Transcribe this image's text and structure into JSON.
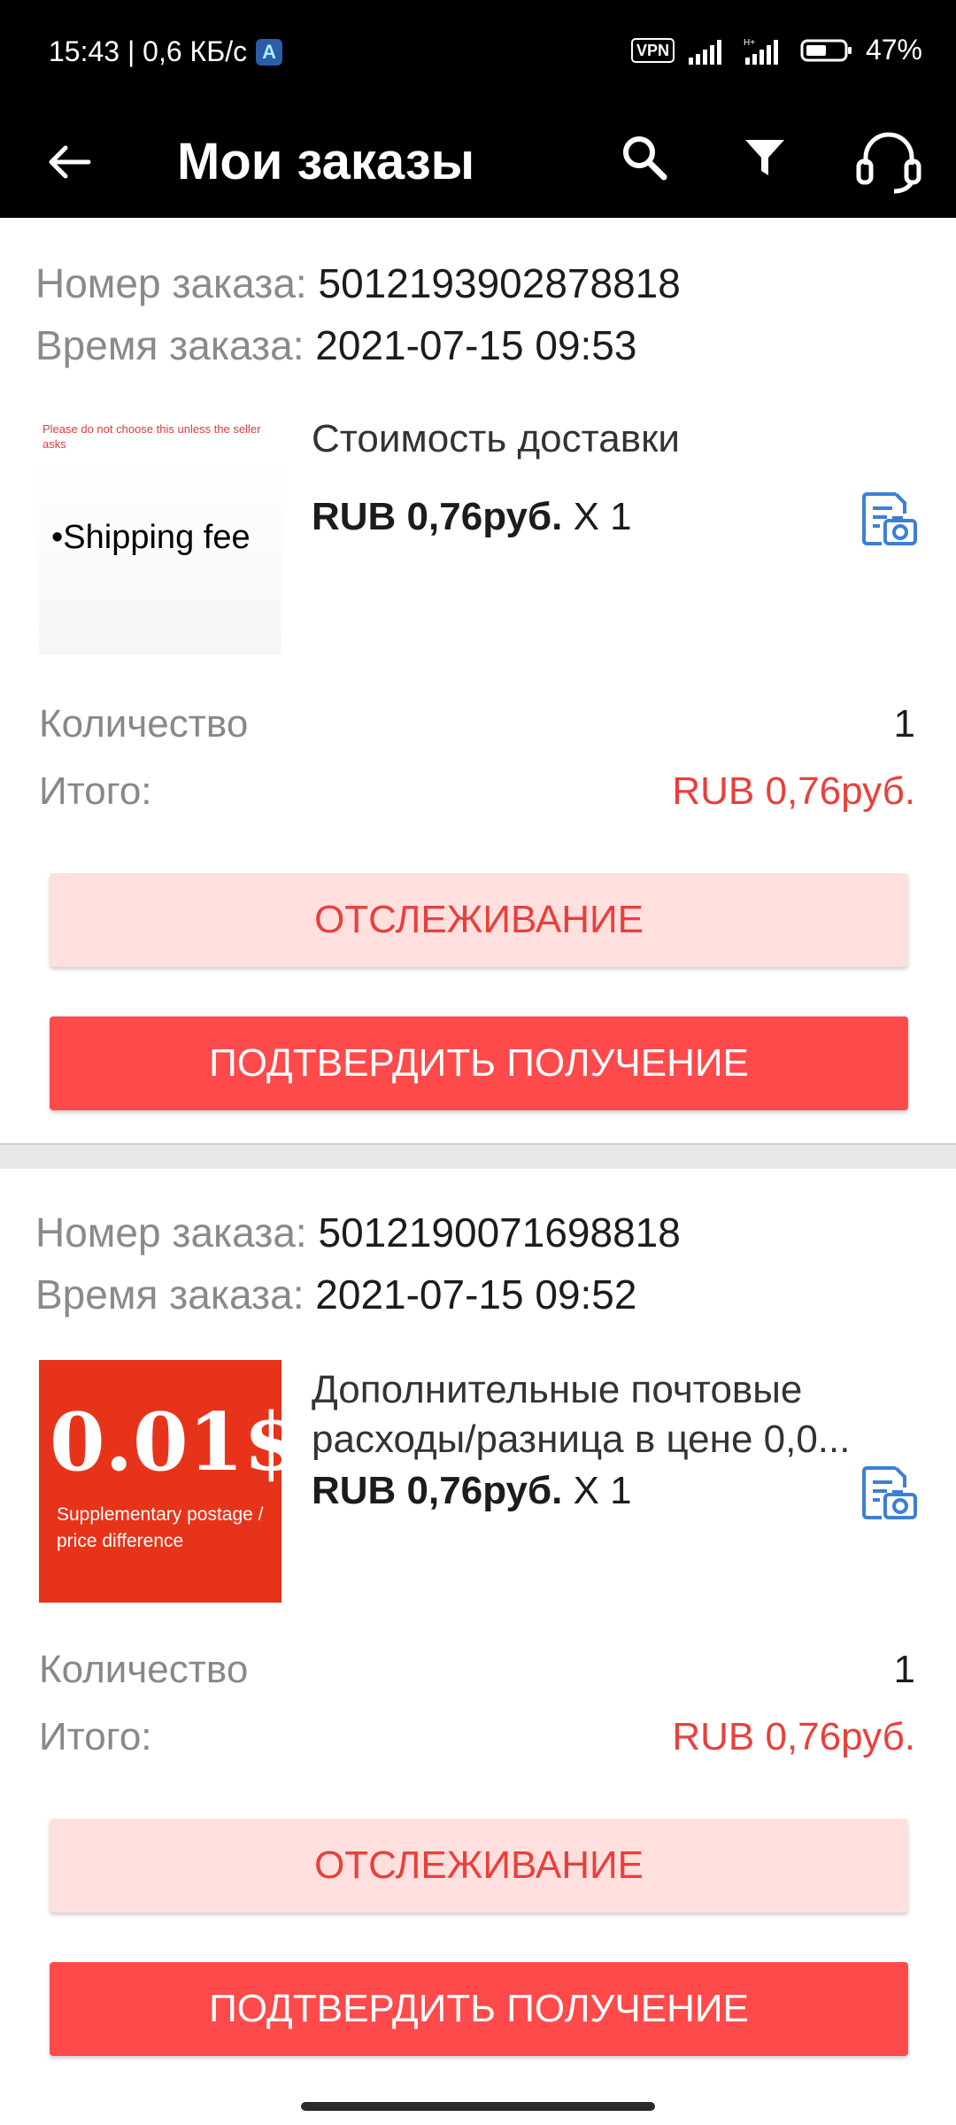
{
  "status_bar": {
    "time_speed": "15:43 | 0,6 КБ/с",
    "app_icon_letter": "A",
    "vpn": "VPN",
    "battery_percent": "47%"
  },
  "app_bar": {
    "title": "Мои заказы",
    "icons": [
      "back-arrow-icon",
      "search-icon",
      "filter-icon",
      "support-headset-icon"
    ]
  },
  "orders": [
    {
      "order_number_label": "Номер заказа:",
      "order_number": "5012193902878818",
      "order_time_label": "Время заказа:",
      "order_time": "2021-07-15 09:53",
      "image": {
        "warning_text": "Please do not choose this unless the seller asks",
        "main_text": "•Shipping fee"
      },
      "product_title": "Стоимость доставки",
      "price": "RUB 0,76руб.",
      "qty_text": "X 1",
      "quantity_label": "Количество",
      "quantity": "1",
      "total_label": "Итого:",
      "total": "RUB 0,76руб.",
      "track_button": "ОТСЛЕЖИВАНИЕ",
      "confirm_button": "ПОДТВЕРДИТЬ ПОЛУЧЕНИЕ"
    },
    {
      "order_number_label": "Номер заказа:",
      "order_number": "5012190071698818",
      "order_time_label": "Время заказа:",
      "order_time": "2021-07-15 09:52",
      "image": {
        "main_text": "0.01$",
        "sub_text": "Supplementary postage / price difference"
      },
      "product_title": "Дополнительные почтовые расходы/разница в цене 0,0...",
      "price": "RUB 0,76руб.",
      "qty_text": "X 1",
      "quantity_label": "Количество",
      "quantity": "1",
      "total_label": "Итого:",
      "total": "RUB 0,76руб.",
      "track_button": "ОТСЛЕЖИВАНИЕ",
      "confirm_button": "ПОДТВЕРДИТЬ ПОЛУЧЕНИЕ"
    }
  ],
  "colors": {
    "accent_red": "#fe4a4b",
    "total_red": "#e8403c",
    "track_bg": "#ffe0df",
    "doc_icon_blue": "#3d7fd6"
  }
}
